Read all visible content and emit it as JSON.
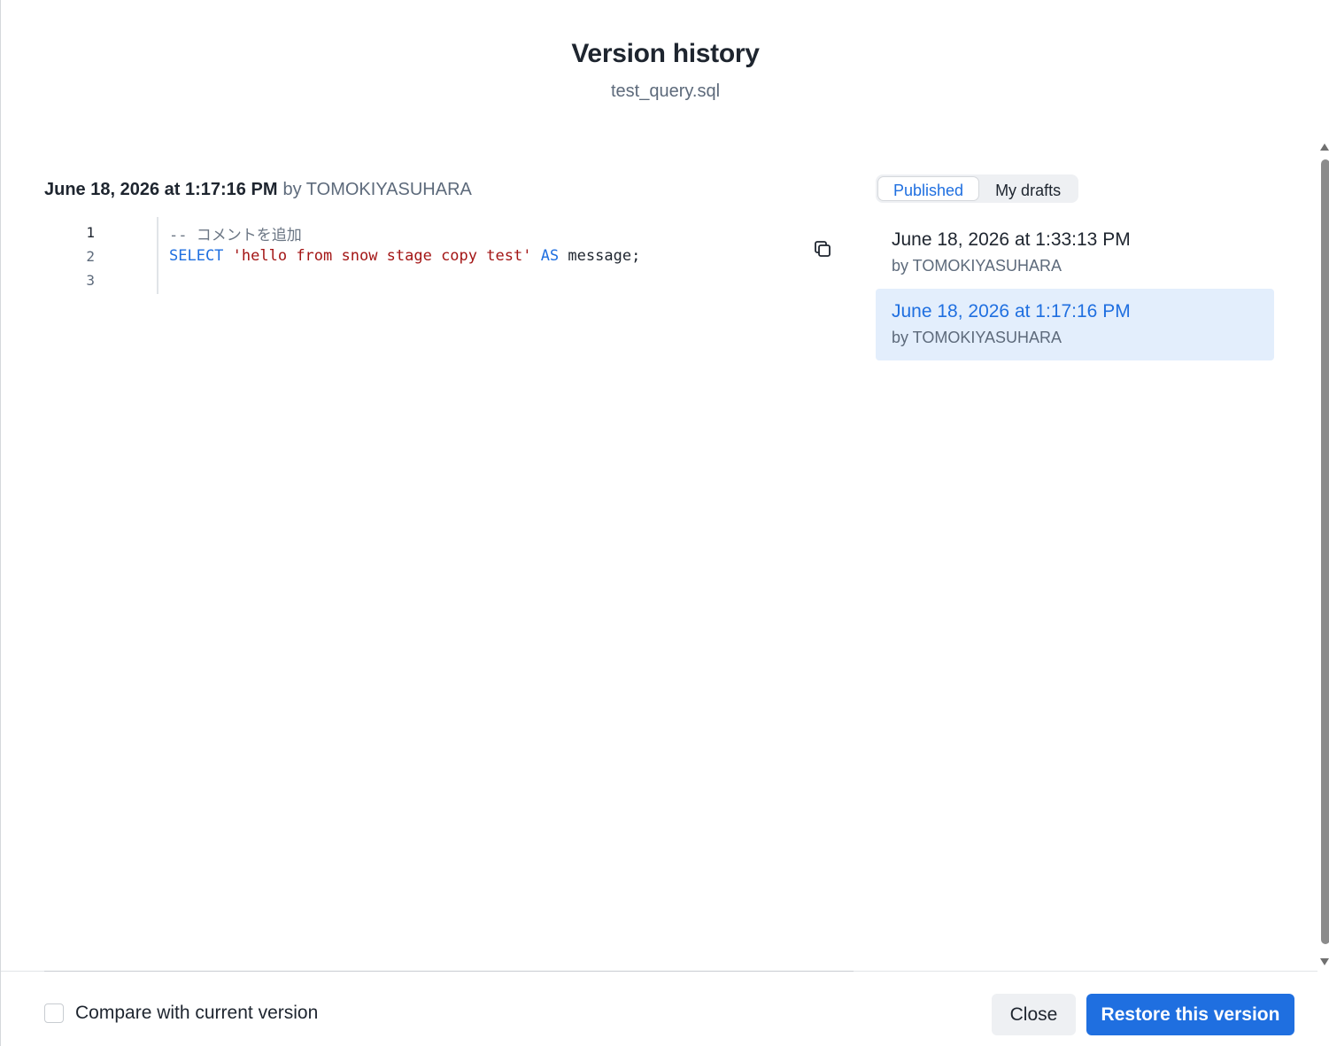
{
  "dialog": {
    "title": "Version history",
    "subtitle": "test_query.sql"
  },
  "selected_version": {
    "date": "June 18, 2026 at 1:17:16 PM",
    "by": "by TOMOKIYASUHARA"
  },
  "code": {
    "line_numbers": [
      "1",
      "2",
      "3"
    ],
    "line1_comment": "-- コメントを追加",
    "line2": {
      "kw_select": "SELECT",
      "string": "'hello from snow stage copy test'",
      "kw_as": "AS",
      "rest": "message;"
    },
    "copy_icon": "copy-icon"
  },
  "tabs": {
    "published": "Published",
    "drafts": "My drafts",
    "active": "published"
  },
  "versions": [
    {
      "date": "June 18, 2026 at 1:33:13 PM",
      "by": "by TOMOKIYASUHARA",
      "selected": false
    },
    {
      "date": "June 18, 2026 at 1:17:16 PM",
      "by": "by TOMOKIYASUHARA",
      "selected": true
    }
  ],
  "footer": {
    "compare_label": "Compare with current version",
    "compare_checked": false,
    "close_label": "Close",
    "restore_label": "Restore this version"
  },
  "colors": {
    "accent": "#1f6fe0",
    "selected_bg": "#e3eefc",
    "keyword": "#1f6fe0",
    "string": "#a31515",
    "comment": "#6b7684"
  }
}
